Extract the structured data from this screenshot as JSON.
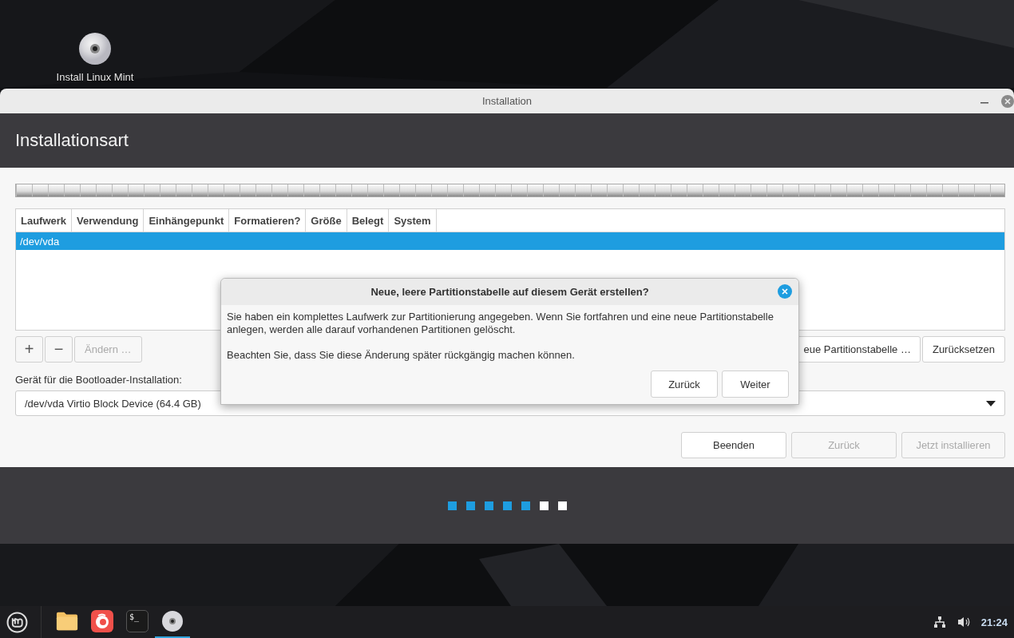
{
  "desktop": {
    "icons": [
      {
        "label": "Install Linux Mint"
      }
    ]
  },
  "window": {
    "title": "Installation"
  },
  "header": {
    "title": "Installationsart"
  },
  "partition_table": {
    "columns": [
      "Laufwerk",
      "Verwendung",
      "Einhängepunkt",
      "Formatieren?",
      "Größe",
      "Belegt",
      "System"
    ],
    "rows": [
      {
        "device": "/dev/vda",
        "selected": true
      }
    ]
  },
  "partition_buttons": [
    {
      "label": "+",
      "disabled": false
    },
    {
      "label": "−",
      "disabled": false
    },
    {
      "label": "Ändern …",
      "disabled": true
    }
  ],
  "table_buttons": [
    {
      "label": "eue Partitionstabelle …",
      "disabled": false
    },
    {
      "label": "Zurücksetzen",
      "disabled": false
    }
  ],
  "bootloader": {
    "label": "Gerät für die Bootloader-Installation:",
    "value": "/dev/vda Virtio Block Device (64.4 GB)"
  },
  "nav_buttons": [
    {
      "label": "Beenden",
      "disabled": false
    },
    {
      "label": "Zurück",
      "disabled": true
    },
    {
      "label": "Jetzt installieren",
      "disabled": true
    }
  ],
  "progress_steps": [
    {
      "completed": true
    },
    {
      "completed": true
    },
    {
      "completed": true
    },
    {
      "completed": true
    },
    {
      "completed": true
    },
    {
      "completed": false
    },
    {
      "completed": false
    }
  ],
  "dialog": {
    "title": "Neue, leere Partitionstabelle auf diesem Gerät erstellen?",
    "paragraphs": [
      "Sie haben ein komplettes Laufwerk zur Partitionierung angegeben. Wenn Sie fortfahren und eine neue Partitionstabelle anlegen, werden alle darauf vorhandenen Partitionen gelöscht.",
      "Beachten Sie, dass Sie diese Änderung später rückgängig machen können."
    ],
    "buttons": [
      "Zurück",
      "Weiter"
    ]
  },
  "taskbar": {
    "apps": [
      {
        "kind": "files",
        "active": false
      },
      {
        "kind": "browser",
        "active": false
      },
      {
        "kind": "terminal",
        "glyph": "$_",
        "active": false
      },
      {
        "kind": "disc",
        "active": true
      }
    ],
    "clock": "21:24"
  }
}
